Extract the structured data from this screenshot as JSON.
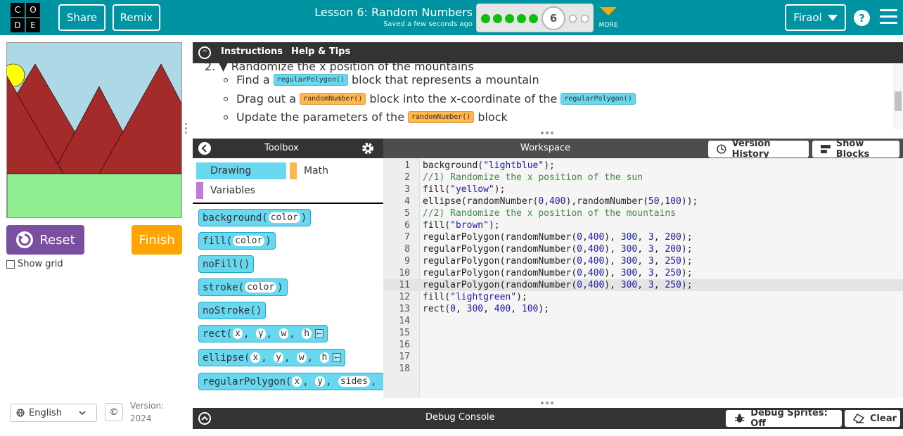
{
  "header": {
    "logo_letters": [
      "C",
      "O",
      "D",
      "E"
    ],
    "share_label": "Share",
    "remix_label": "Remix",
    "lesson_title": "Lesson 6: Random Numbers",
    "saved_status": "Saved a few seconds ago",
    "current_level": "6",
    "completed_levels": 5,
    "remaining_levels": 2,
    "more_label": "MORE",
    "user_name": "Firaol",
    "help_label": "?"
  },
  "preview": {
    "show_grid_label": "Show grid",
    "reset_label": "Reset",
    "finish_label": "Finish"
  },
  "footer": {
    "language": "English",
    "copyright_symbol": "©",
    "version_label": "Version:",
    "version_value": "2024"
  },
  "instructions": {
    "tab_instructions": "Instructions",
    "tab_help": "Help & Tips",
    "step_heading": "2. ▼ Randomize the x position of the mountains",
    "bullets": [
      {
        "pre": "Find a",
        "chip1": "regularPolygon()",
        "mid": "block that represents a mountain"
      },
      {
        "pre": "Drag out a",
        "chip1": "randomNumber()",
        "mid": "block into the x-coordinate of the",
        "chip2": "regularPolygon()"
      },
      {
        "pre": "Update the parameters of the",
        "chip1": "randomNumber()",
        "mid": "block"
      }
    ]
  },
  "toolbox": {
    "title": "Toolbox",
    "categories": [
      "Drawing",
      "Math",
      "Variables"
    ],
    "blocks": [
      {
        "name": "background(",
        "args": [
          "color"
        ],
        "end": ")"
      },
      {
        "name": "fill(",
        "args": [
          "color"
        ],
        "end": ")"
      },
      {
        "name": "noFill()",
        "args": [],
        "end": ""
      },
      {
        "name": "stroke(",
        "args": [
          "color"
        ],
        "end": ")"
      },
      {
        "name": "noStroke()",
        "args": [],
        "end": ""
      },
      {
        "name": "rect(",
        "args": [
          "x",
          "y",
          "w",
          "h"
        ],
        "end": ""
      },
      {
        "name": "ellipse(",
        "args": [
          "x",
          "y",
          "w",
          "h"
        ],
        "end": ""
      },
      {
        "name": "regularPolygon(",
        "args": [
          "x",
          "y",
          "sides"
        ],
        "end": ""
      }
    ]
  },
  "workspace": {
    "title": "Workspace",
    "version_history_label": "Version History",
    "show_blocks_label": "Show Blocks",
    "active_line": 11,
    "line_numbers": [
      "1",
      "2",
      "3",
      "4",
      "5",
      "6",
      "7",
      "8",
      "9",
      "10",
      "11",
      "12",
      "13",
      "14",
      "15",
      "16",
      "17",
      "18"
    ],
    "code_lines": [
      "background(\"lightblue\");",
      "//1) Randomize the x position of the sun",
      "fill(\"yellow\");",
      "ellipse(randomNumber(0,400),randomNumber(50,100));",
      "//2) Randomize the x position of the mountains",
      "fill(\"brown\");",
      "regularPolygon(randomNumber(0,400), 300, 3, 200);",
      "regularPolygon(randomNumber(0,400), 300, 3, 200);",
      "regularPolygon(randomNumber(0,400), 300, 3, 250);",
      "regularPolygon(randomNumber(0,400), 300, 3, 250);",
      "regularPolygon(randomNumber(0,400), 300, 3, 250);",
      "fill(\"lightgreen\");",
      "rect(0, 300, 400, 100);",
      "",
      "",
      "",
      "",
      ""
    ]
  },
  "debug": {
    "title": "Debug Console",
    "sprites_label": "Debug Sprites: Off",
    "clear_label": "Clear"
  },
  "colors": {
    "header_bg": "#0094a3",
    "block_blue": "#68d8f0",
    "block_orange": "#ffb74d",
    "reset_purple": "#7b4fa0",
    "finish_orange": "#ffa400",
    "progress_green": "#0ebe0e",
    "string_color": "#1a1aa6",
    "comment_color": "#3d8b3d",
    "number_color": "#1a1aa6"
  }
}
